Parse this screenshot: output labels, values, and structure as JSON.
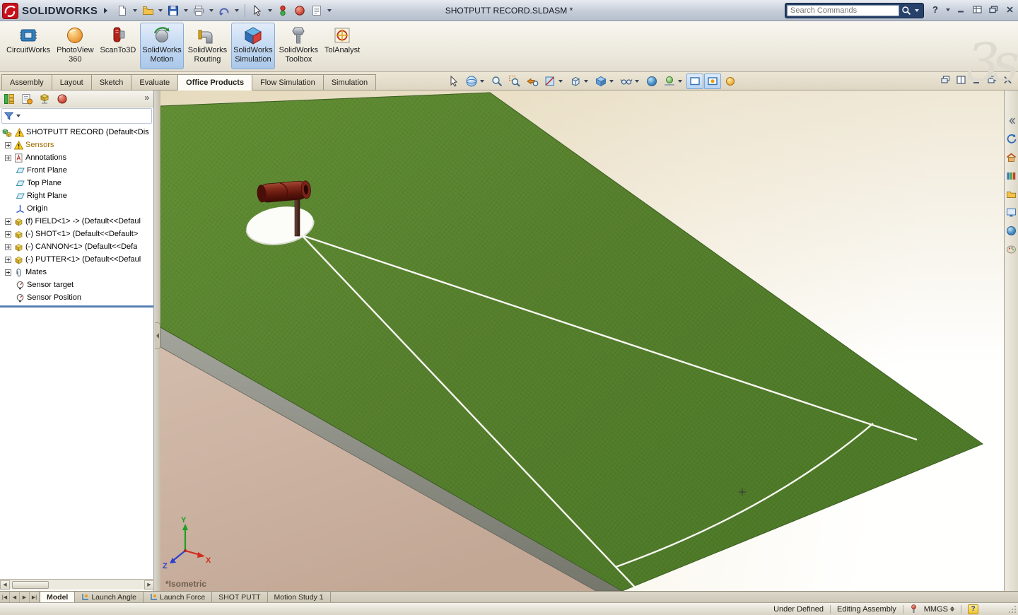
{
  "titlebar": {
    "app_name": "SOLIDWORKS",
    "document_title": "SHOTPUTT RECORD.SLDASM *",
    "search_placeholder": "Search Commands",
    "help_label": "?"
  },
  "watermark": "3s",
  "ribbon": {
    "addins": [
      {
        "line1": "CircuitWorks",
        "line2": "",
        "pressed": false
      },
      {
        "line1": "PhotoView",
        "line2": "360",
        "pressed": false
      },
      {
        "line1": "ScanTo3D",
        "line2": "",
        "pressed": false
      },
      {
        "line1": "SolidWorks",
        "line2": "Motion",
        "pressed": true
      },
      {
        "line1": "SolidWorks",
        "line2": "Routing",
        "pressed": false
      },
      {
        "line1": "SolidWorks",
        "line2": "Simulation",
        "pressed": true
      },
      {
        "line1": "SolidWorks",
        "line2": "Toolbox",
        "pressed": false
      },
      {
        "line1": "TolAnalyst",
        "line2": "",
        "pressed": false
      }
    ]
  },
  "command_tabs": {
    "items": [
      {
        "label": "Assembly"
      },
      {
        "label": "Layout"
      },
      {
        "label": "Sketch"
      },
      {
        "label": "Evaluate"
      },
      {
        "label": "Office Products"
      },
      {
        "label": "Flow Simulation"
      },
      {
        "label": "Simulation"
      }
    ],
    "active": "Office Products"
  },
  "feature_panel": {
    "more_label": "»",
    "tree": {
      "items": [
        {
          "label": "SHOTPUTT RECORD  (Default<Dis"
        },
        {
          "label": "Sensors"
        },
        {
          "label": "Annotations"
        },
        {
          "label": "Front Plane"
        },
        {
          "label": "Top Plane"
        },
        {
          "label": "Right Plane"
        },
        {
          "label": "Origin"
        },
        {
          "label": "(f) FIELD<1> -> (Default<<Defaul"
        },
        {
          "label": "(-) SHOT<1> (Default<<Default>"
        },
        {
          "label": "(-) CANNON<1> (Default<<Defa"
        },
        {
          "label": "(-) PUTTER<1> (Default<<Defaul"
        },
        {
          "label": "Mates"
        },
        {
          "label": "Sensor target"
        },
        {
          "label": "Sensor Position"
        }
      ]
    }
  },
  "viewport": {
    "view_label": "*Isometric",
    "triad": {
      "x": "X",
      "y": "Y",
      "z": "Z"
    }
  },
  "model_tabs": {
    "items": [
      {
        "label": "Model"
      },
      {
        "label": "Launch Angle"
      },
      {
        "label": "Launch Force"
      },
      {
        "label": "SHOT PUTT"
      },
      {
        "label": "Motion Study 1"
      }
    ],
    "active": "Model"
  },
  "statusbar": {
    "constraint_status": "Under Defined",
    "mode": "Editing Assembly",
    "units": "MMGS"
  },
  "colors": {
    "field_green": "#54812c",
    "accent_blue": "#3a76b4",
    "pressed_blue": "#bed5f0",
    "cannon_red": "#6a1a10"
  },
  "icons": {
    "search-icon": "magnifier",
    "filter-icon": "funnel",
    "warning-icon": "yellow-triangle-!",
    "plane-icon": "teal-parallelogram",
    "origin-icon": "blue-axes",
    "part-icon": "yellow-cube",
    "assembly-icon": "cube-stack",
    "mates-icon": "paperclip",
    "sensor-icon": "gauge",
    "help-icon": "?",
    "close-icon": "x",
    "minimize-icon": "dash"
  }
}
